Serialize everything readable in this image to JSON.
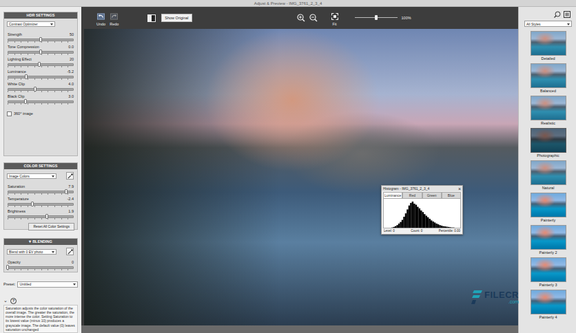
{
  "window": {
    "title": "Adjust & Preview - IMG_3761_2_3_4"
  },
  "hdr_settings": {
    "title": "HDR SETTINGS",
    "method": "Contrast Optimizer",
    "sliders": [
      {
        "label": "Strength",
        "value": "50",
        "level": 0.5
      },
      {
        "label": "Tone Compression",
        "value": "0.0",
        "level": 0.5
      },
      {
        "label": "Lighting Effect",
        "value": "20",
        "level": 0.48
      },
      {
        "label": "Luminance",
        "value": "-5.2",
        "level": 0.28
      },
      {
        "label": "White Clip",
        "value": "4.0",
        "level": 0.42
      },
      {
        "label": "Black Clip",
        "value": "3.0",
        "level": 0.27
      }
    ],
    "checkbox": {
      "label": "360° image",
      "checked": false
    }
  },
  "color_settings": {
    "title": "COLOR SETTINGS",
    "mode": "Image Colors",
    "sliders": [
      {
        "label": "Saturation",
        "value": "7.9",
        "level": 0.89
      },
      {
        "label": "Temperature",
        "value": "-2.4",
        "level": 0.38
      },
      {
        "label": "Brightness",
        "value": "1.9",
        "level": 0.59
      }
    ],
    "reset_button": "Reset All Color Settings"
  },
  "blending": {
    "title": "BLENDING",
    "toggle": "▾",
    "mode": "Blend with 0 EV photo",
    "sliders": [
      {
        "label": "Opacity",
        "value": "0",
        "level": 0.0
      }
    ]
  },
  "preset": {
    "label": "Preset:",
    "value": "Untitled"
  },
  "help": {
    "toggle": "⌄",
    "icon": "?",
    "text": "Saturation adjusts the color saturation of the overall image. The greater the saturation, the more intense the color. Setting Saturation to its lowest value (minus 10) produces a grayscale image. The default value (0) leaves saturation unchanged"
  },
  "toolbar": {
    "undo": "Undo",
    "redo": "Redo",
    "show_original": "Show Original",
    "fit": "Fit",
    "zoom": {
      "level": 0.5,
      "reading": "100%"
    }
  },
  "histogram": {
    "title": "Histogram - IMG_3761_2_3_4",
    "close": "×",
    "tabs": [
      {
        "label": "Luminance",
        "selected": true
      },
      {
        "label": "Red",
        "selected": false
      },
      {
        "label": "Green",
        "selected": false
      },
      {
        "label": "Blue",
        "selected": false
      }
    ],
    "values": [
      0,
      0,
      1,
      3,
      6,
      10,
      16,
      22,
      30,
      42,
      55,
      70,
      85,
      95,
      100,
      92,
      88,
      80,
      74,
      66,
      60,
      52,
      46,
      40,
      34,
      28,
      24,
      20,
      16,
      13,
      10,
      8,
      6,
      5,
      4,
      3,
      2,
      1,
      1,
      0
    ],
    "footer": [
      {
        "label": "Level:",
        "value": "0"
      },
      {
        "label": "Count:",
        "value": "0"
      },
      {
        "label": "Percentile:",
        "value": "0.00"
      }
    ]
  },
  "styles": {
    "filter": "All Styles",
    "items": [
      {
        "label": "Detailed",
        "selected": false
      },
      {
        "label": "Balanced",
        "selected": false
      },
      {
        "label": "Realistic",
        "selected": false
      },
      {
        "label": "Photographic",
        "selected": false
      },
      {
        "label": "Natural",
        "selected": false
      },
      {
        "label": "Painterly",
        "selected": false
      },
      {
        "label": "Painterly 2",
        "selected": false
      },
      {
        "label": "Painterly 3",
        "selected": false
      },
      {
        "label": "Painterly 4",
        "selected": false
      }
    ]
  },
  "watermark": {
    "brand": "FILECR",
    "domain": ".com"
  }
}
